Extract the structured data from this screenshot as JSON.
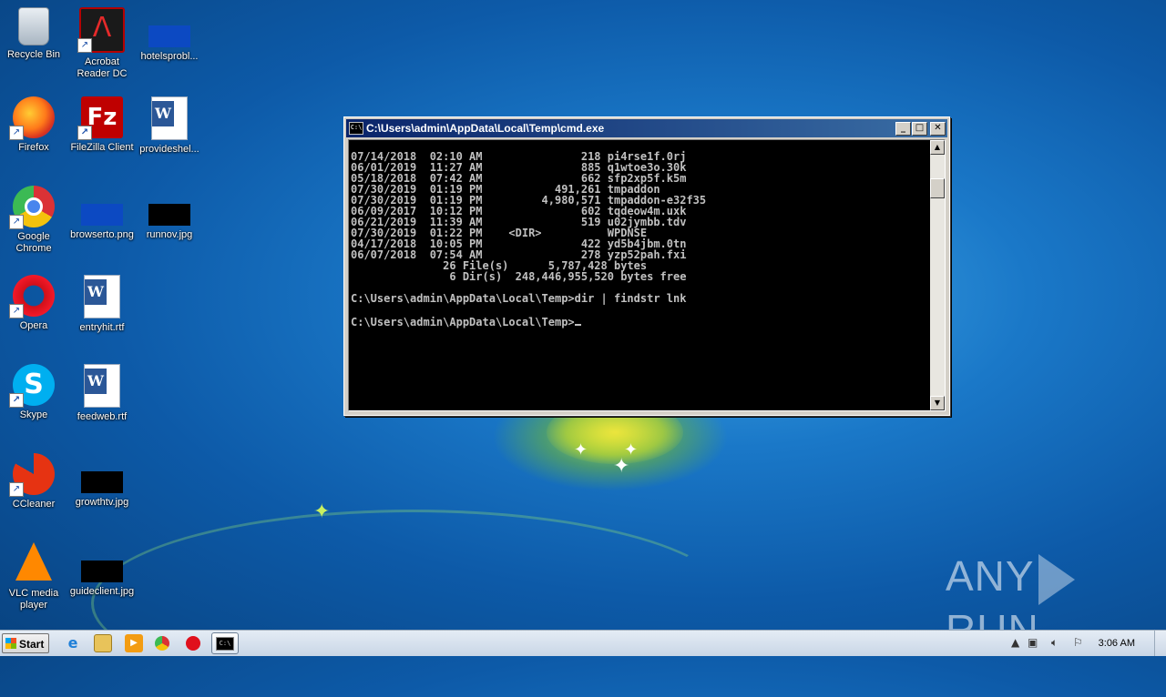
{
  "desktop": {
    "icons": [
      {
        "label": "Recycle Bin",
        "icon": "recycle-bin-icon"
      },
      {
        "label": "Acrobat Reader DC",
        "icon": "acrobat-reader-icon"
      },
      {
        "label": "hotelsprobl...",
        "icon": "image-file-icon"
      },
      {
        "label": "Firefox",
        "icon": "firefox-icon"
      },
      {
        "label": "FileZilla Client",
        "icon": "filezilla-icon"
      },
      {
        "label": "provideshel...",
        "icon": "word-document-icon"
      },
      {
        "label": "Google Chrome",
        "icon": "chrome-icon"
      },
      {
        "label": "browserto.png",
        "icon": "image-file-icon"
      },
      {
        "label": "runnov.jpg",
        "icon": "image-file-icon"
      },
      {
        "label": "Opera",
        "icon": "opera-icon"
      },
      {
        "label": "entryhit.rtf",
        "icon": "word-document-icon"
      },
      {
        "label": "Skype",
        "icon": "skype-icon"
      },
      {
        "label": "feedweb.rtf",
        "icon": "word-document-icon"
      },
      {
        "label": "CCleaner",
        "icon": "ccleaner-icon"
      },
      {
        "label": "growthtv.jpg",
        "icon": "image-file-icon"
      },
      {
        "label": "VLC media player",
        "icon": "vlc-icon"
      },
      {
        "label": "guideclient.jpg",
        "icon": "image-file-icon"
      }
    ]
  },
  "cmd_window": {
    "title": "C:\\Users\\admin\\AppData\\Local\\Temp\\cmd.exe",
    "minimize": "_",
    "maximize": "□",
    "close": "✕",
    "lines": [
      "07/14/2018  02:10 AM               218 pi4rse1f.0rj",
      "06/01/2019  11:27 AM               885 q1wtoe3o.30k",
      "05/18/2018  07:42 AM               662 sfp2xp5f.k5m",
      "07/30/2019  01:19 PM           491,261 tmpaddon",
      "07/30/2019  01:19 PM         4,980,571 tmpaddon-e32f35",
      "06/09/2017  10:12 PM               602 tqdeow4m.uxk",
      "06/21/2019  11:39 AM               519 u02jymbb.tdv",
      "07/30/2019  01:22 PM    <DIR>          WPDNSE",
      "04/17/2018  10:05 PM               422 yd5b4jbm.0tn",
      "06/07/2018  07:54 AM               278 yzp52pah.fxi",
      "              26 File(s)      5,787,428 bytes",
      "               6 Dir(s)  248,446,955,520 bytes free",
      "",
      "C:\\Users\\admin\\AppData\\Local\\Temp>dir | findstr lnk",
      ""
    ],
    "prompt": "C:\\Users\\admin\\AppData\\Local\\Temp>"
  },
  "taskbar": {
    "start_label": "Start",
    "pinned": [
      "internet-explorer-icon",
      "explorer-icon",
      "media-player-icon",
      "chrome-icon",
      "opera-icon",
      "cmd-icon"
    ],
    "clock": "3:06 AM"
  },
  "watermark": {
    "left": "ANY",
    "right": "RUN"
  }
}
